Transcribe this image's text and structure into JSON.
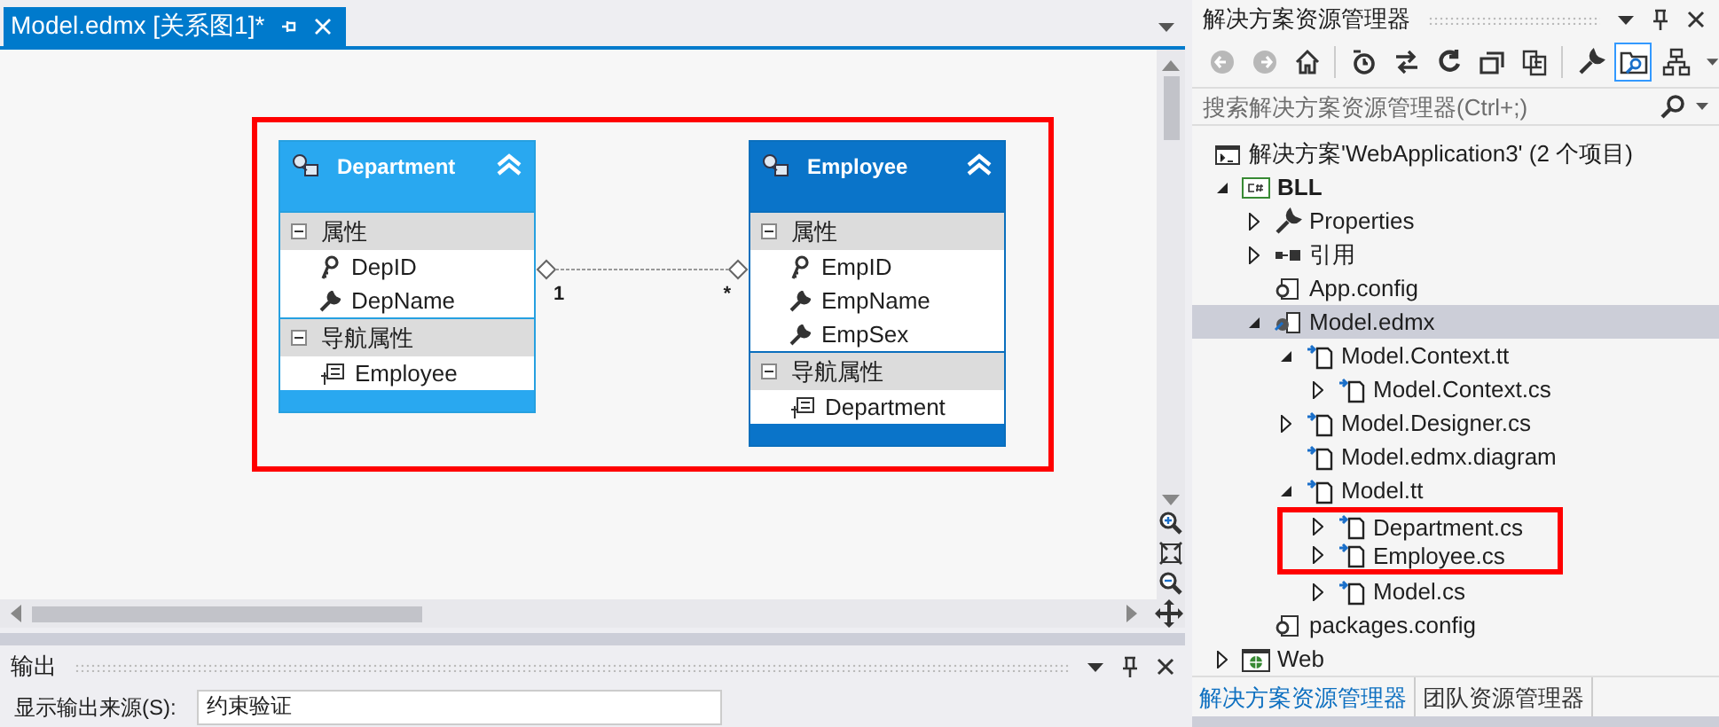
{
  "document_tab": {
    "title": "Model.edmx [关系图1]*"
  },
  "diagram": {
    "entities": [
      {
        "name": "Department",
        "selected": false,
        "sections": [
          {
            "title": "属性",
            "expanded": true,
            "items": [
              {
                "kind": "key",
                "name": "DepID"
              },
              {
                "kind": "property",
                "name": "DepName"
              }
            ]
          },
          {
            "title": "导航属性",
            "expanded": true,
            "items": [
              {
                "kind": "navigation",
                "name": "Employee"
              }
            ]
          }
        ]
      },
      {
        "name": "Employee",
        "selected": true,
        "sections": [
          {
            "title": "属性",
            "expanded": true,
            "items": [
              {
                "kind": "key",
                "name": "EmpID"
              },
              {
                "kind": "property",
                "name": "EmpName"
              },
              {
                "kind": "property",
                "name": "EmpSex"
              }
            ]
          },
          {
            "title": "导航属性",
            "expanded": true,
            "items": [
              {
                "kind": "navigation",
                "name": "Department"
              }
            ]
          }
        ]
      }
    ],
    "association": {
      "end_1": "1",
      "end_2": "*"
    }
  },
  "output_panel": {
    "title": "输出",
    "source_label": "显示输出来源(S):",
    "source_value": "约束验证"
  },
  "solution_explorer": {
    "title": "解决方案资源管理器",
    "toolbar": [
      {
        "kind": "back",
        "disabled": true
      },
      {
        "kind": "forward",
        "disabled": true
      },
      {
        "kind": "home",
        "disabled": false
      },
      {
        "kind": "history",
        "disabled": false
      },
      {
        "kind": "sync",
        "disabled": false
      },
      {
        "kind": "refresh",
        "disabled": false
      },
      {
        "kind": "collapse",
        "disabled": false
      },
      {
        "kind": "copy",
        "disabled": false
      },
      {
        "kind": "properties",
        "disabled": false
      },
      {
        "kind": "show-files",
        "disabled": false,
        "on": true
      },
      {
        "kind": "diagram",
        "disabled": false
      }
    ],
    "search": {
      "placeholder": "搜索解决方案资源管理器(Ctrl+;)"
    },
    "tree": [
      {
        "label": "解决方案'WebApplication3' (2 个项目)",
        "kind": "solution",
        "selected": false,
        "children": [
          {
            "label": "BLL",
            "kind": "csharp",
            "expanded": true,
            "bold": true,
            "selected": false,
            "children": [
              {
                "label": "Properties",
                "kind": "wrench",
                "expanded": false,
                "selected": false
              },
              {
                "label": "引用",
                "kind": "reference",
                "expanded": false,
                "selected": false
              },
              {
                "label": "App.config",
                "kind": "config",
                "selected": false
              },
              {
                "label": "Model.edmx",
                "kind": "edmx",
                "expanded": true,
                "selected": true,
                "children": [
                  {
                    "label": "Model.Context.tt",
                    "kind": "generated",
                    "expanded": true,
                    "selected": false,
                    "children": [
                      {
                        "label": "Model.Context.cs",
                        "kind": "generated",
                        "expanded": false,
                        "selected": false
                      }
                    ]
                  },
                  {
                    "label": "Model.Designer.cs",
                    "kind": "generated",
                    "expanded": false,
                    "selected": false
                  },
                  {
                    "label": "Model.edmx.diagram",
                    "kind": "generated",
                    "selected": false
                  },
                  {
                    "label": "Model.tt",
                    "kind": "generated",
                    "expanded": true,
                    "selected": false,
                    "children": [
                      {
                        "label": "Department.cs",
                        "kind": "generated",
                        "expanded": false,
                        "selected": false,
                        "annotated": true
                      },
                      {
                        "label": "Employee.cs",
                        "kind": "generated",
                        "expanded": false,
                        "selected": false,
                        "annotated": true
                      },
                      {
                        "label": "Model.cs",
                        "kind": "generated",
                        "expanded": false,
                        "selected": false
                      }
                    ]
                  }
                ]
              },
              {
                "label": "packages.config",
                "kind": "config",
                "selected": false
              }
            ]
          },
          {
            "label": "Web",
            "kind": "web",
            "expanded": false,
            "selected": false
          }
        ]
      }
    ],
    "bottom_tabs": [
      {
        "label": "解决方案资源管理器",
        "selected": true
      },
      {
        "label": "团队资源管理器",
        "selected": false
      }
    ]
  }
}
